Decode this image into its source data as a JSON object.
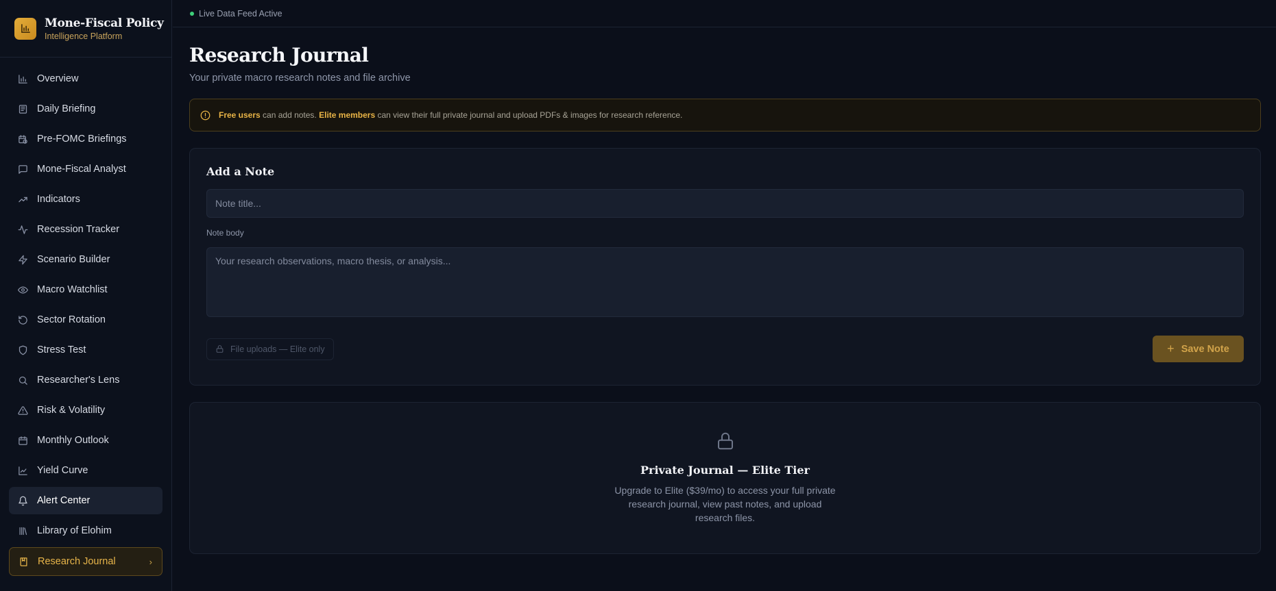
{
  "brand": {
    "name": "Mone-Fiscal Policy",
    "subtitle": "Intelligence Platform",
    "accent": "#e4ad3a"
  },
  "sidebar": {
    "items": [
      {
        "label": "Overview",
        "icon": "bar-chart-icon"
      },
      {
        "label": "Daily Briefing",
        "icon": "newspaper-icon"
      },
      {
        "label": "Pre-FOMC Briefings",
        "icon": "calendar-clock-icon"
      },
      {
        "label": "Mone-Fiscal Analyst",
        "icon": "message-square-icon"
      },
      {
        "label": "Indicators",
        "icon": "trending-up-icon"
      },
      {
        "label": "Recession Tracker",
        "icon": "activity-icon"
      },
      {
        "label": "Scenario Builder",
        "icon": "zap-icon"
      },
      {
        "label": "Macro Watchlist",
        "icon": "eye-icon"
      },
      {
        "label": "Sector Rotation",
        "icon": "rotate-ccw-icon"
      },
      {
        "label": "Stress Test",
        "icon": "shield-icon"
      },
      {
        "label": "Researcher's Lens",
        "icon": "search-icon"
      },
      {
        "label": "Risk & Volatility",
        "icon": "alert-triangle-icon"
      },
      {
        "label": "Monthly Outlook",
        "icon": "calendar-icon"
      },
      {
        "label": "Yield Curve",
        "icon": "line-chart-icon"
      },
      {
        "label": "Alert Center",
        "icon": "bell-icon"
      },
      {
        "label": "Library of Elohim",
        "icon": "library-icon"
      },
      {
        "label": "Research Journal",
        "icon": "book-icon"
      }
    ],
    "active": "Research Journal",
    "hovered": "Alert Center"
  },
  "topbar": {
    "status": "Live Data Feed Active",
    "status_color": "#3ed07a"
  },
  "page": {
    "title": "Research Journal",
    "subtitle": "Your private macro research notes and file archive"
  },
  "banner": {
    "free_label": "Free users",
    "free_text": " can add notes. ",
    "elite_label": "Elite members",
    "elite_text": " can view their full private journal and upload PDFs & images for research reference."
  },
  "note_form": {
    "title": "Add a Note",
    "title_placeholder": "Note title...",
    "body_label": "Note body",
    "body_placeholder": "Your research observations, macro thesis, or analysis...",
    "upload_label": "File uploads — Elite only",
    "save_label": "Save Note"
  },
  "locked": {
    "title": "Private Journal — Elite Tier",
    "description": "Upgrade to Elite ($39/mo) to access your full private research journal, view past notes, and upload research files."
  }
}
